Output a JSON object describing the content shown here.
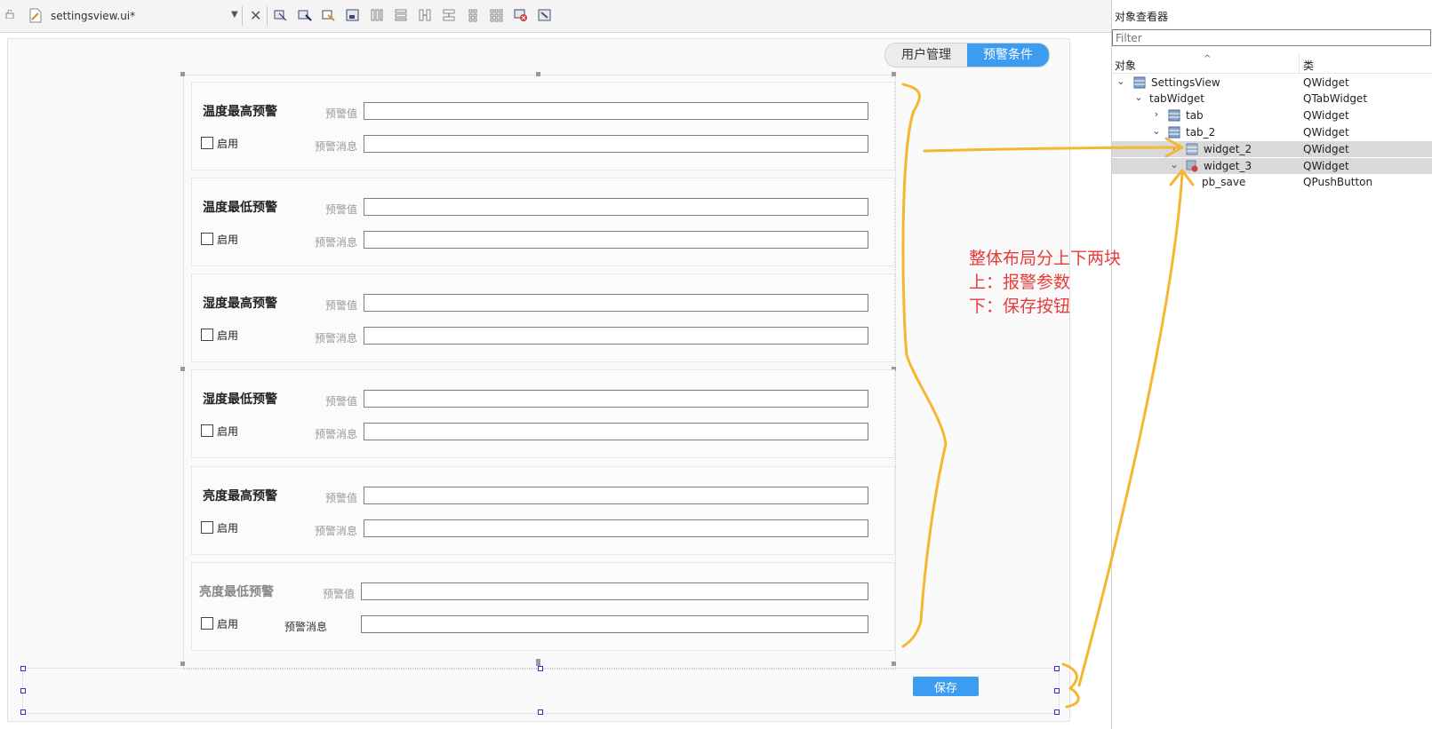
{
  "toolbar": {
    "filename": "settingsview.ui*",
    "icons": [
      "lock-icon",
      "file-edit-icon",
      "chevron-down-icon",
      "close-icon",
      "layout-icons"
    ]
  },
  "inspector": {
    "title": "对象查看器",
    "filter_placeholder": "Filter",
    "col_object": "对象",
    "col_class": "类",
    "rows": [
      {
        "name": "SettingsView",
        "class": "QWidget",
        "expanded": true,
        "depth": 0
      },
      {
        "name": "tabWidget",
        "class": "QTabWidget",
        "expanded": true,
        "depth": 1
      },
      {
        "name": "tab",
        "class": "QWidget",
        "expanded": false,
        "depth": 2
      },
      {
        "name": "tab_2",
        "class": "QWidget",
        "expanded": true,
        "depth": 2
      },
      {
        "name": "widget_2",
        "class": "QWidget",
        "expanded": false,
        "depth": 3
      },
      {
        "name": "widget_3",
        "class": "QWidget",
        "expanded": true,
        "depth": 3
      },
      {
        "name": "pb_save",
        "class": "QPushButton",
        "expanded": false,
        "depth": 3
      }
    ]
  },
  "tabs": {
    "user_mgmt": "用户管理",
    "alarm_cond": "预警条件"
  },
  "groups": [
    {
      "title": "温度最高预警",
      "value_label": "预警值",
      "msg_label": "预警消息",
      "enable_label": "启用"
    },
    {
      "title": "温度最低预警",
      "value_label": "预警值",
      "msg_label": "预警消息",
      "enable_label": "启用"
    },
    {
      "title": "湿度最高预警",
      "value_label": "预警值",
      "msg_label": "预警消息",
      "enable_label": "启用"
    },
    {
      "title": "湿度最低预警",
      "value_label": "预警值",
      "msg_label": "预警消息",
      "enable_label": "启用"
    },
    {
      "title": "亮度最高预警",
      "value_label": "预警值",
      "msg_label": "预警消息",
      "enable_label": "启用"
    },
    {
      "title": "亮度最低预警",
      "value_label": "预警值",
      "msg_label": "预警消息",
      "enable_label": "启用"
    }
  ],
  "save_button": "保存",
  "annotation": {
    "line1": "整体布局分上下两块",
    "line2": "上：报警参数",
    "line3": "下：保存按钮"
  },
  "colors": {
    "accent": "#3b9cf0",
    "annotation": "#e83a3a",
    "arrow": "#f5b731"
  }
}
